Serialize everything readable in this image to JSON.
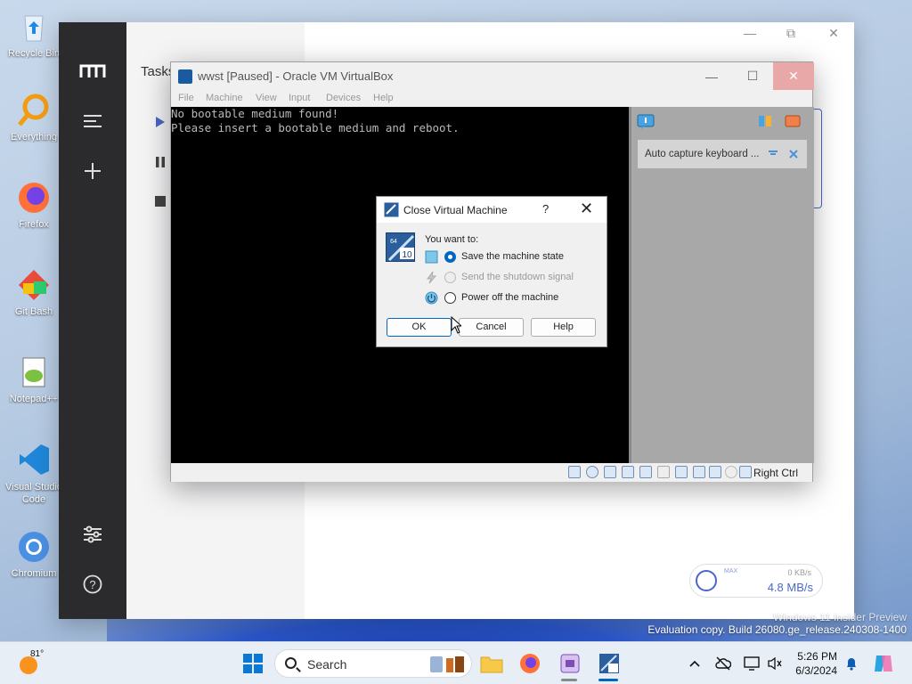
{
  "desktop": {
    "icons": [
      {
        "label": "Recycle Bin",
        "name": "recycle-bin-icon"
      },
      {
        "label": "Everything",
        "name": "everything-icon"
      },
      {
        "label": "Firefox",
        "name": "firefox-icon"
      },
      {
        "label": "Git Bash",
        "name": "git-bash-icon"
      },
      {
        "label": "Notepad++",
        "name": "notepad-plus-plus-icon"
      },
      {
        "label": "Visual Studio Code",
        "name": "vscode-icon"
      },
      {
        "label": "Chromium",
        "name": "chromium-icon"
      }
    ],
    "watermark_line1": "Windows 11 Insider Preview",
    "watermark_line2": "Evaluation copy. Build 26080.ge_release.240308-1400"
  },
  "app": {
    "sub_title": "Tasks",
    "speed": {
      "max_label": "MAX",
      "upload": "0 KB/s",
      "download": "4.8 MB/s"
    }
  },
  "vbox": {
    "title": "wwst [Paused] - Oracle VM VirtualBox",
    "menu": [
      "File",
      "Machine",
      "View",
      "Input",
      "Devices",
      "Help"
    ],
    "screen_lines": [
      "No bootable medium found!",
      "Please insert a bootable medium and reboot."
    ],
    "side_message": "Auto capture keyboard ...",
    "host_key": "Right Ctrl"
  },
  "dialog": {
    "title": "Close Virtual Machine",
    "help_glyph": "?",
    "prompt": "You want to:",
    "options": [
      {
        "label": "Save the machine state",
        "selected": true,
        "enabled": true
      },
      {
        "label": "Send the shutdown signal",
        "selected": false,
        "enabled": false
      },
      {
        "label": "Power off the machine",
        "selected": false,
        "enabled": true
      }
    ],
    "buttons": {
      "ok": "OK",
      "cancel": "Cancel",
      "help": "Help"
    }
  },
  "taskbar": {
    "weather_temp": "81°",
    "search_label": "Search",
    "time": "5:26 PM",
    "date": "6/3/2024"
  },
  "colors": {
    "accent": "#0067c0",
    "rail": "#2b2b2e",
    "motrix_blue": "#4a67c9"
  }
}
